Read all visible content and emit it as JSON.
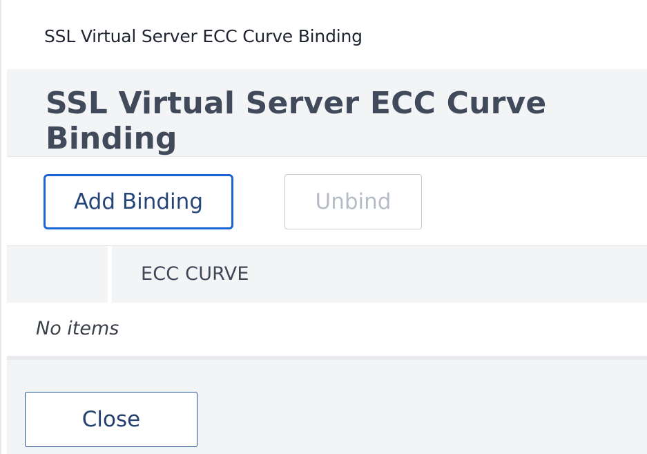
{
  "breadcrumb": "SSL Virtual Server ECC Curve Binding",
  "title": "SSL Virtual Server ECC Curve Binding",
  "toolbar": {
    "add_binding_label": "Add Binding",
    "unbind_label": "Unbind"
  },
  "table": {
    "columns": [
      "ECC CURVE"
    ],
    "empty_message": "No items"
  },
  "footer": {
    "close_label": "Close"
  },
  "colors": {
    "primary_border": "#1a64d6",
    "band_background": "#f3f4f6",
    "disabled_text": "#b6bcc6"
  }
}
